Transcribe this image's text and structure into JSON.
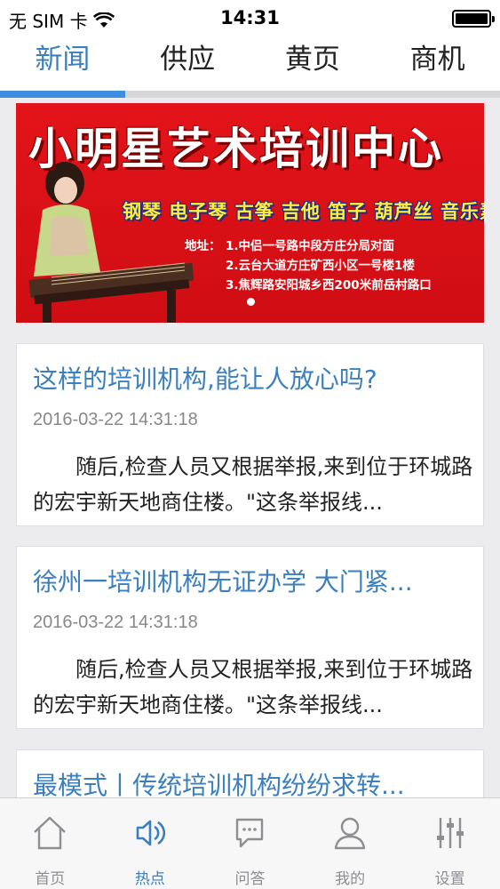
{
  "status_bar": {
    "carrier": "无 SIM 卡",
    "time": "14:31"
  },
  "tabs": [
    {
      "label": "新闻",
      "active": true
    },
    {
      "label": "供应",
      "active": false
    },
    {
      "label": "黄页",
      "active": false
    },
    {
      "label": "商机",
      "active": false
    }
  ],
  "banner": {
    "title": "小明星艺术培训中心",
    "subjects": "钢琴 电子琴 古筝 吉他 笛子 葫芦丝 音乐素养 等",
    "address_label": "地址：",
    "address_lines": [
      "1.中侣一号路中段方庄分局对面",
      "2.云台大道方庄矿西小区一号楼1楼",
      "3.焦辉路安阳城乡西200米前岳村路口"
    ]
  },
  "news": [
    {
      "title": "这样的培训机构,能让人放心吗?",
      "date": "2016-03-22 14:31:18",
      "summary": "随后,检查人员又根据举报,来到位于环城路的宏宇新天地商住楼。\"这条举报线..."
    },
    {
      "title": "徐州一培训机构无证办学 大门紧...",
      "date": "2016-03-22 14:31:18",
      "summary": "随后,检查人员又根据举报,来到位于环城路的宏宇新天地商住楼。\"这条举报线..."
    },
    {
      "title": "最模式丨传统培训机构纷纷求转...",
      "date": "",
      "summary": ""
    }
  ],
  "bottom_nav": [
    {
      "label": "首页",
      "icon": "home-icon",
      "active": false
    },
    {
      "label": "热点",
      "icon": "hotspot-icon",
      "active": true
    },
    {
      "label": "问答",
      "icon": "chat-icon",
      "active": false
    },
    {
      "label": "我的",
      "icon": "user-icon",
      "active": false
    },
    {
      "label": "设置",
      "icon": "settings-sliders-icon",
      "active": false
    }
  ],
  "colors": {
    "accent": "#3b7fbe",
    "indicator": "#3d8ee0",
    "banner_red": "#e3141a",
    "inactive": "#8e8e93"
  }
}
